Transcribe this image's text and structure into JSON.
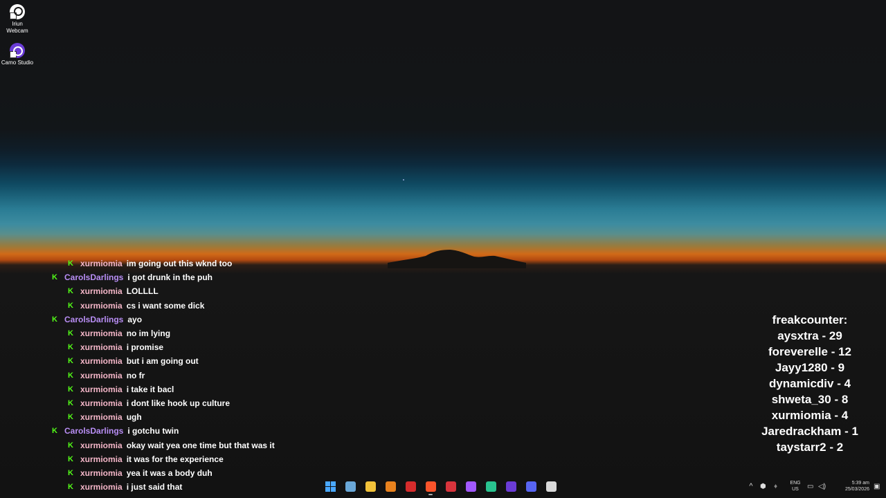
{
  "desktop": {
    "icons": [
      {
        "label_line1": "Iriun",
        "label_line2": "Webcam",
        "icon": "iriun-webcam-icon"
      },
      {
        "label_line1": "Camo Studio",
        "icon": "camo-studio-icon"
      }
    ]
  },
  "chat": {
    "messages": [
      {
        "user": "xurmiomia",
        "text": "im going out this wknd too"
      },
      {
        "user": "CarolsDarlings",
        "text": "i got drunk in the puh"
      },
      {
        "user": "xurmiomia",
        "text": "LOLLLL"
      },
      {
        "user": "xurmiomia",
        "text": "cs i want some dick"
      },
      {
        "user": "CarolsDarlings",
        "text": "ayo"
      },
      {
        "user": "xurmiomia",
        "text": "no im lying"
      },
      {
        "user": "xurmiomia",
        "text": "i promise"
      },
      {
        "user": "xurmiomia",
        "text": "but i am going out"
      },
      {
        "user": "xurmiomia",
        "text": "no fr"
      },
      {
        "user": "xurmiomia",
        "text": "i take it bacl"
      },
      {
        "user": "xurmiomia",
        "text": "i dont like hook up culture"
      },
      {
        "user": "xurmiomia",
        "text": "ugh"
      },
      {
        "user": "CarolsDarlings",
        "text": "i gotchu twin"
      },
      {
        "user": "xurmiomia",
        "text": "okay wait yea one time but that was it"
      },
      {
        "user": "xurmiomia",
        "text": "it was for the experience"
      },
      {
        "user": "xurmiomia",
        "text": "yea it was a body duh"
      },
      {
        "user": "xurmiomia",
        "text": "i just said that"
      }
    ],
    "badge_glyph": "K",
    "colors": {
      "badge": "#53fc18",
      "xurmiomia": "#f4b6c8",
      "CarolsDarlings": "#b98ef5"
    }
  },
  "counter": {
    "title": "freakcounter:",
    "entries": [
      "aysxtra - 29",
      "foreverelle - 12",
      "Jayy1280 - 9",
      "dynamicdiv - 4",
      "shweta_30 - 8",
      "xurmiomia - 4",
      "Jaredrackham - 1",
      "taystarr2 - 2"
    ]
  },
  "taskbar": {
    "apps": [
      {
        "name": "start-button",
        "color": "#4aa8ff"
      },
      {
        "name": "widgets-icon",
        "color": "#6aa8d8"
      },
      {
        "name": "file-explorer-icon",
        "color": "#f2c23a"
      },
      {
        "name": "firefox-icon",
        "color": "#e8821e"
      },
      {
        "name": "video-app-icon",
        "color": "#d62c2c"
      },
      {
        "name": "brave-browser-icon",
        "color": "#fb542b",
        "active": true
      },
      {
        "name": "red-app-icon",
        "color": "#d8343c"
      },
      {
        "name": "figma-icon",
        "color": "#a259ff"
      },
      {
        "name": "green-app-icon",
        "color": "#29c38f"
      },
      {
        "name": "camo-studio-taskbar-icon",
        "color": "#6a3cd6"
      },
      {
        "name": "discord-icon",
        "color": "#5865f2"
      },
      {
        "name": "snipping-tool-icon",
        "color": "#d9d9d9"
      }
    ],
    "tray": {
      "lang_line1": "ENG",
      "lang_line2": "US",
      "time": "5:39 am",
      "date": "25/03/2026"
    }
  }
}
